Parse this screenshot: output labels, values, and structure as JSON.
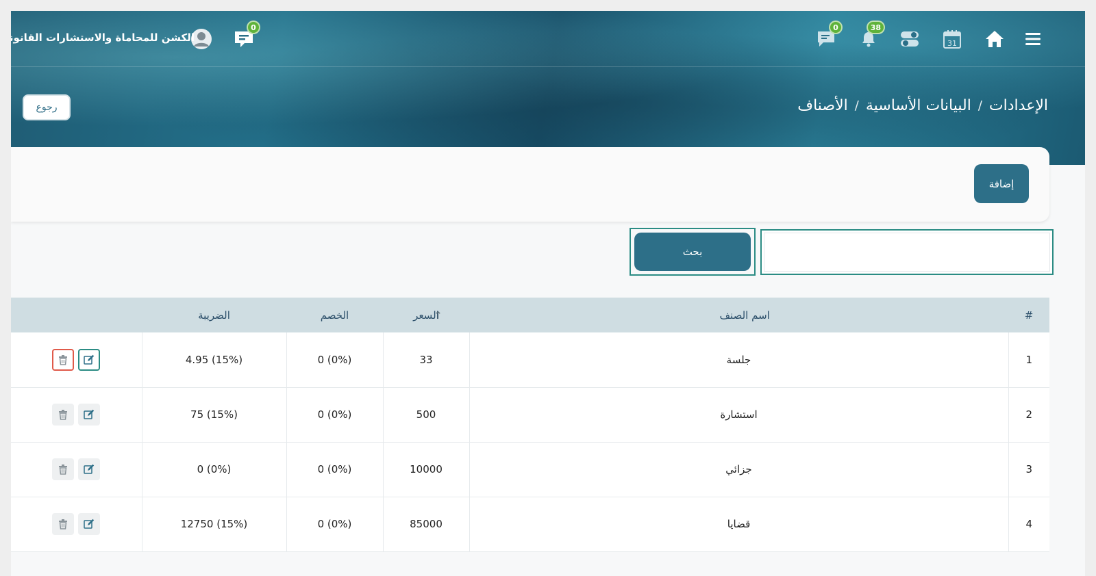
{
  "topbar": {
    "firm_name": "الكشن للمحاماة والاستشارات القانونية",
    "chat_badge": "0",
    "messages_badge": "0",
    "notifications_badge": "38",
    "calendar_day": "31"
  },
  "breadcrumb": {
    "items": [
      "الإعدادات",
      "البيانات الأساسية",
      "الأصناف"
    ],
    "separator": "/"
  },
  "back_label": "رجوع",
  "add_label": "إضافة",
  "search": {
    "value": "",
    "placeholder": "",
    "button_label": "بحث"
  },
  "table": {
    "headers": {
      "index": "#",
      "name": "اسم الصنف",
      "price": "السعر",
      "discount": "الخصم",
      "tax": "الضريبة",
      "actions": ""
    },
    "rows": [
      {
        "index": "1",
        "name": "جلسة",
        "price": "33",
        "discount": "(0%) 0",
        "tax": "(15%) 4.95"
      },
      {
        "index": "2",
        "name": "استشارة",
        "price": "500",
        "discount": "(0%) 0",
        "tax": "(15%) 75"
      },
      {
        "index": "3",
        "name": "جزائي",
        "price": "10000",
        "discount": "(0%) 0",
        "tax": "(0%) 0"
      },
      {
        "index": "4",
        "name": "قضايا",
        "price": "85000",
        "discount": "(0%) 0",
        "tax": "(15%) 12750"
      }
    ]
  },
  "colors": {
    "primary": "#2d6f88",
    "accent_border": "#2b8c84",
    "badge": "#5fb33a",
    "delete_highlight": "#e05a4a",
    "header_row": "#cfdde2"
  }
}
